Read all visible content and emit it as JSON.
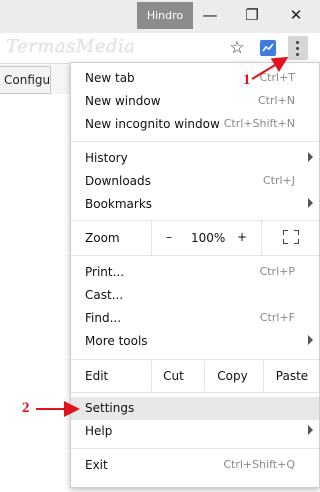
{
  "window": {
    "user_name": "Hindro",
    "minimize_glyph": "—",
    "restore_glyph": "❐",
    "close_glyph": "✕"
  },
  "toolbar": {
    "watermark": "TermasMedia",
    "bookmark_star_glyph": "☆",
    "extension_icon": "chart-extension-icon",
    "menu_icon": "three-dot-menu-icon"
  },
  "bookmarks_bar": {
    "item_label": "Configur"
  },
  "menu": {
    "new_tab": {
      "label": "New tab",
      "shortcut": "Ctrl+T"
    },
    "new_window": {
      "label": "New window",
      "shortcut": "Ctrl+N"
    },
    "new_incognito": {
      "label": "New incognito window",
      "shortcut": "Ctrl+Shift+N"
    },
    "history": {
      "label": "History"
    },
    "downloads": {
      "label": "Downloads",
      "shortcut": "Ctrl+J"
    },
    "bookmarks": {
      "label": "Bookmarks"
    },
    "zoom": {
      "label": "Zoom",
      "minus": "–",
      "value": "100%",
      "plus": "+"
    },
    "print": {
      "label": "Print...",
      "shortcut": "Ctrl+P"
    },
    "cast": {
      "label": "Cast..."
    },
    "find": {
      "label": "Find...",
      "shortcut": "Ctrl+F"
    },
    "more_tools": {
      "label": "More tools"
    },
    "edit": {
      "label": "Edit",
      "cut": "Cut",
      "copy": "Copy",
      "paste": "Paste"
    },
    "settings": {
      "label": "Settings"
    },
    "help": {
      "label": "Help"
    },
    "exit": {
      "label": "Exit",
      "shortcut": "Ctrl+Shift+Q"
    }
  },
  "annotations": {
    "step1": "1",
    "step2": "2",
    "color": "#e0141e"
  }
}
